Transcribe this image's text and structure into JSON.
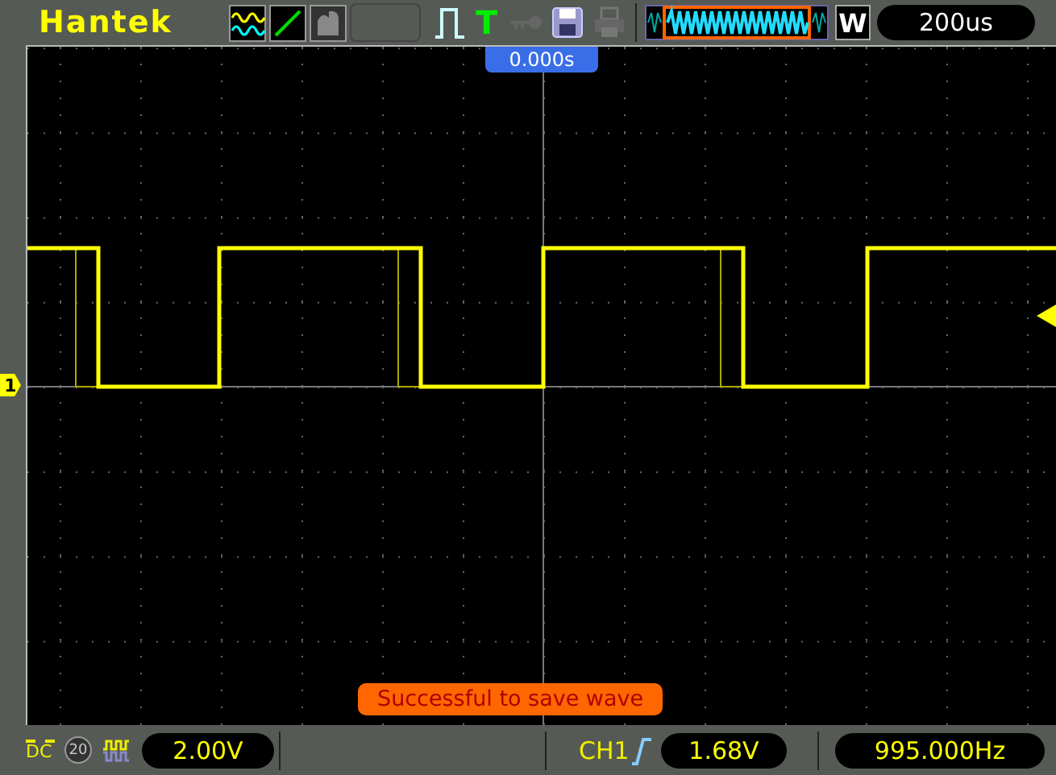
{
  "brand": "Hantek",
  "trigger_indicator": "T",
  "window_mode": "W",
  "timebase": "200us",
  "trigger_position": "0.000s",
  "channel_marker": "1",
  "message": "Successful to save wave",
  "channel": {
    "coupling": "DC",
    "bandwidth_limit": {
      "label": "20",
      "on": false
    },
    "scale": "2.00V"
  },
  "trigger": {
    "source": "CH1",
    "level": "1.68V"
  },
  "frequency": "995.000Hz"
}
